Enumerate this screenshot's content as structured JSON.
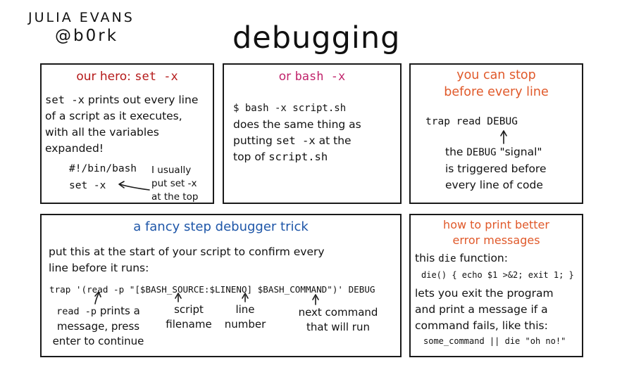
{
  "signature": {
    "name": "Julia Evans",
    "handle": "@b0rk"
  },
  "title": "debugging",
  "panel1": {
    "title_prefix": "our hero:",
    "title_code": "set -x",
    "body": [
      {
        "code": "set -x",
        "text": " prints out every line"
      },
      {
        "code": "",
        "text": "of a script as it executes,"
      },
      {
        "code": "",
        "text": "with all the variables"
      },
      {
        "code": "",
        "text": "expanded!"
      }
    ],
    "code_lines": [
      "#!/bin/bash",
      "set -x"
    ],
    "note": [
      "I usually",
      "put set -x",
      "at the top"
    ]
  },
  "panel2": {
    "title_prefix": "or",
    "title_code": "bash -x",
    "command": "$ bash -x script.sh",
    "body": [
      {
        "pre": "does the same thing as",
        "code": "",
        "post": ""
      },
      {
        "pre": "putting ",
        "code": "set -x",
        "post": " at the"
      },
      {
        "pre": "top of ",
        "code": "script.sh",
        "post": ""
      }
    ]
  },
  "panel3": {
    "title": [
      "you can stop",
      "before every line"
    ],
    "command": "trap read DEBUG",
    "note": [
      {
        "pre": "the ",
        "code": "DEBUG",
        "post": " \"signal\""
      },
      {
        "pre": "is triggered before",
        "code": "",
        "post": ""
      },
      {
        "pre": "every line of code",
        "code": "",
        "post": ""
      }
    ]
  },
  "panel4": {
    "title": "a fancy step debugger trick",
    "intro": [
      "put this at the start of your script to confirm every",
      "line before it runs:"
    ],
    "command": "trap '(read -p \"[$BASH_SOURCE:$LINENO] $BASH_COMMAND\")' DEBUG",
    "labels": [
      {
        "line1_code": "read -p",
        "line1_text": " prints a",
        "rest": [
          "message, press",
          "enter to continue"
        ]
      },
      {
        "line1_code": "",
        "line1_text": "script",
        "rest": [
          "filename"
        ]
      },
      {
        "line1_code": "",
        "line1_text": "line",
        "rest": [
          "number"
        ]
      },
      {
        "line1_code": "",
        "line1_text": "next command",
        "rest": [
          "that will run"
        ]
      }
    ]
  },
  "panel5": {
    "title": [
      "how to print better",
      "error messages"
    ],
    "intro_pre": "this ",
    "intro_code": "die",
    "intro_post": " function:",
    "code": "die() { echo $1 >&2; exit 1; }",
    "body": [
      "lets you exit the program",
      "and print a message if a",
      "command fails, like this:"
    ],
    "example": "some_command || die \"oh no!\""
  },
  "colors": {
    "red": "#b51a1a",
    "pink": "#c1246c",
    "orange": "#e0592a",
    "blue": "#1e56a8",
    "ink": "#1a1a1a"
  }
}
